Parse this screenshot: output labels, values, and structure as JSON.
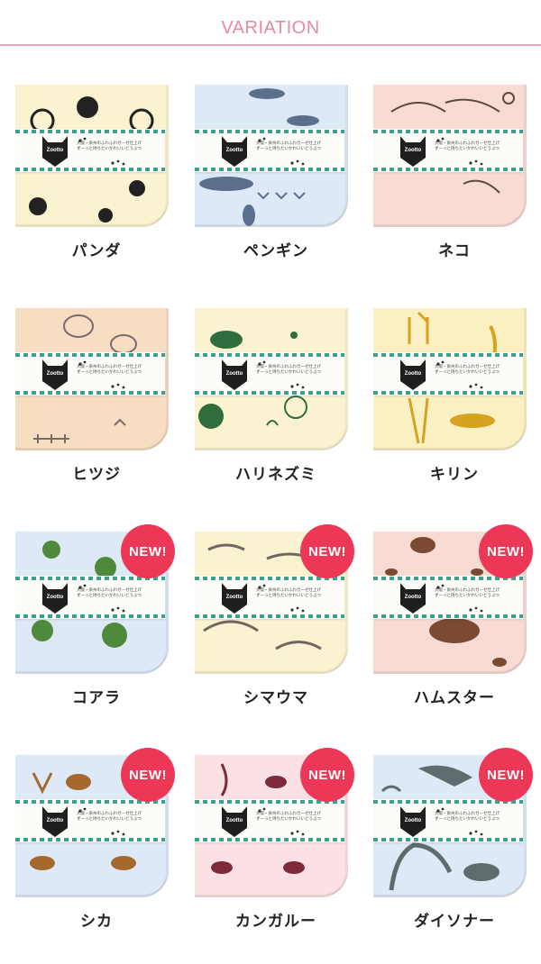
{
  "header": {
    "title": "VARIATION",
    "accent_color": "#e88a9e"
  },
  "band": {
    "logo_text": "Zootto",
    "text_line1": "大阪・泉州のふわふわガーゼ仕上げ",
    "text_line2": "ずーっと持ちたいかわいいどうぶつ"
  },
  "badge_label": "NEW!",
  "items": [
    {
      "name": "パンダ",
      "color": "#fbf3cf",
      "motif": "#222222",
      "new": false
    },
    {
      "name": "ペンギン",
      "color": "#dde9f6",
      "motif": "#5b6f8c",
      "new": false
    },
    {
      "name": "ネコ",
      "color": "#f8dcd4",
      "motif": "#5a4a44",
      "new": false
    },
    {
      "name": "ヒツジ",
      "color": "#f7ddc1",
      "motif": "#7a6a6a",
      "new": false
    },
    {
      "name": "ハリネズミ",
      "color": "#fbf3cf",
      "motif": "#2f6e3c",
      "new": false
    },
    {
      "name": "キリン",
      "color": "#fbf0c2",
      "motif": "#d6a21f",
      "new": false
    },
    {
      "name": "コアラ",
      "color": "#dde9f6",
      "motif": "#4f8a3c",
      "new": true
    },
    {
      "name": "シマウマ",
      "color": "#fbf3cf",
      "motif": "#6e6660",
      "new": true
    },
    {
      "name": "ハムスター",
      "color": "#f8dcd4",
      "motif": "#7a4a32",
      "new": true
    },
    {
      "name": "シカ",
      "color": "#dde9f6",
      "motif": "#a5692e",
      "new": true
    },
    {
      "name": "カンガルー",
      "color": "#fbe1e4",
      "motif": "#7c2a3a",
      "new": true
    },
    {
      "name": "ダイソナー",
      "color": "#dde9f6",
      "motif": "#5f6b6c",
      "new": true
    }
  ]
}
